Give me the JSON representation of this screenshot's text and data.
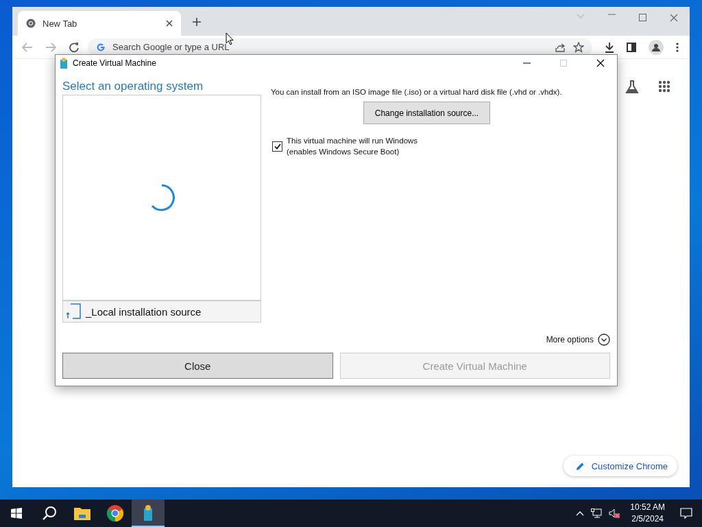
{
  "browser": {
    "tabs": [
      {
        "label": "New Tab",
        "selected": true
      }
    ],
    "address_bar": {
      "placeholder": "Search Google or type a URL"
    },
    "customize_button": "Customize Chrome"
  },
  "dialog": {
    "title": "Create Virtual Machine",
    "heading": "Select an operating system",
    "os_list": {
      "loading": true
    },
    "source_item": {
      "label": "_Local installation source"
    },
    "description": "You can install from an ISO image file (.iso) or a virtual hard disk file (.vhd or .vhdx).",
    "change_button": "Change installation source...",
    "windows_checkbox": {
      "label_lines": [
        "This virtual machine will run Windows",
        "(enables Windows Secure Boot)"
      ],
      "checked": true
    },
    "more_options": "More options",
    "buttons": [
      {
        "label": "Close",
        "disabled": false
      },
      {
        "label": "Create Virtual Machine",
        "disabled": true
      }
    ]
  },
  "taskbar": {
    "clock": {
      "time": "10:52 AM",
      "date": "2/5/2024"
    }
  }
}
